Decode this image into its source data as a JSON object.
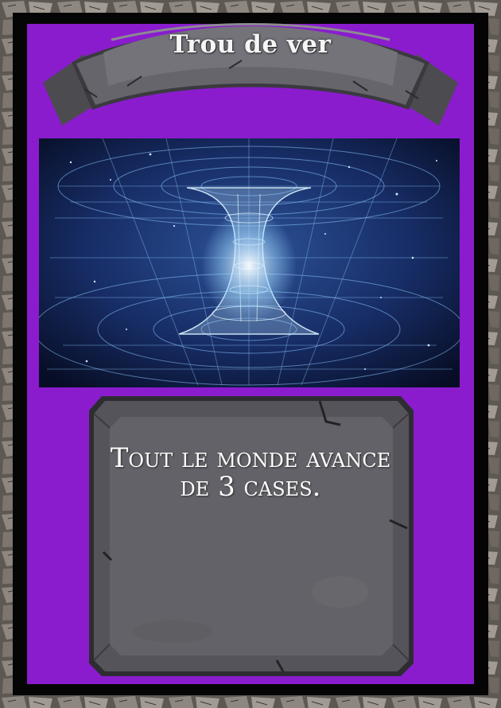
{
  "card": {
    "title": "Trou de ver",
    "effect": "Tout le monde avance de 3 cases.",
    "illustration": "wormhole"
  },
  "colors": {
    "frame_purple": "#8a1cce",
    "frame_black": "#050505",
    "stone_panel": "#636268",
    "space_blue": "#0d1e4a",
    "grid_glow": "#9fd8ff"
  }
}
